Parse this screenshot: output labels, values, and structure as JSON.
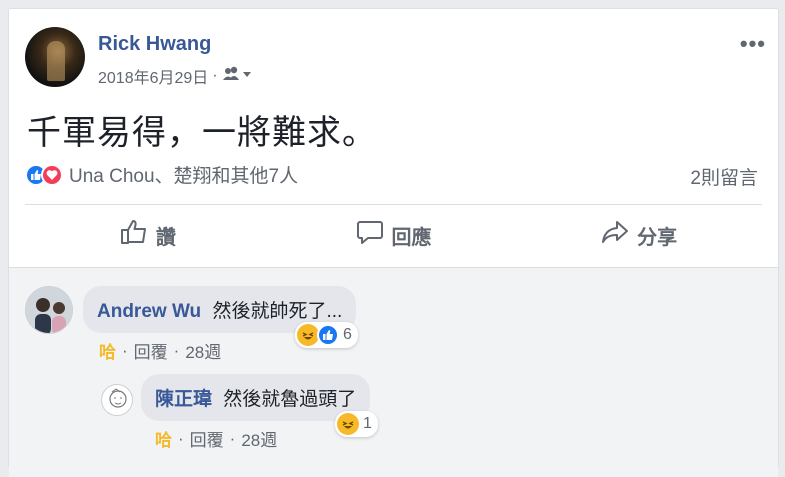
{
  "post": {
    "author": "Rick Hwang",
    "date": "2018年6月29日",
    "separator": "·",
    "text": "千軍易得，一將難求。",
    "reactions_text": "Una Chou、楚翔和其他7人",
    "comments_count": "2則留言"
  },
  "actions": {
    "like": "讚",
    "comment": "回應",
    "share": "分享"
  },
  "comments": [
    {
      "name": "Andrew Wu",
      "text": "然後就帥死了...",
      "haha": "哈",
      "reply": "回覆",
      "time": "28週",
      "dot": "·",
      "reaction_count": "6"
    },
    {
      "name": "陳正瑋",
      "text": "然後就魯過頭了",
      "haha": "哈",
      "reply": "回覆",
      "time": "28週",
      "dot": "·",
      "reaction_count": "1"
    }
  ],
  "colors": {
    "link": "#385898",
    "like": "#1877f2",
    "love": "#f33e58",
    "haha": "#f7b928"
  }
}
